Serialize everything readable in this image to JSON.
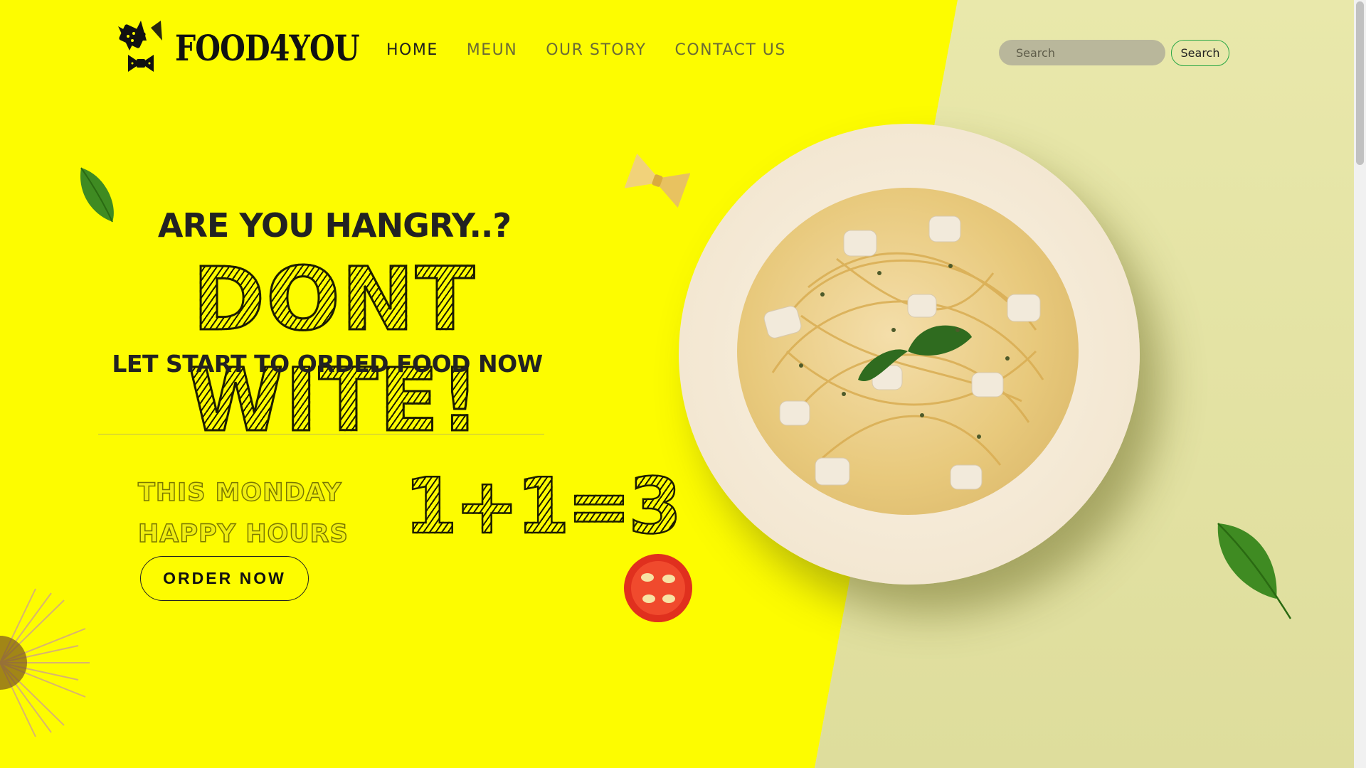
{
  "brand": {
    "name": "FOOD4YOU"
  },
  "nav": {
    "items": [
      {
        "label": "HOME",
        "active": true
      },
      {
        "label": "MEUN",
        "active": false
      },
      {
        "label": "OUR STORY",
        "active": false
      },
      {
        "label": "CONTACT US",
        "active": false
      }
    ]
  },
  "search": {
    "placeholder": "Search",
    "button_label": "Search"
  },
  "hero": {
    "line1": "ARE YOU HANGRY..?",
    "line2": "DONT WITE!",
    "line3": "LET START TO ORDED FOOD NOW"
  },
  "promo": {
    "line1": "THIS MONDAY",
    "line2": "HAPPY HOURS",
    "deal": "1+1=3",
    "button_label": "ORDER NOW"
  },
  "colors": {
    "background_yellow": "#fdfc00",
    "background_beige": "#e4e2a0",
    "search_button_border": "#28a745"
  },
  "icons": {
    "logo": "bow-tie-pasta-icon",
    "decorations": [
      "basil-leaf-icon",
      "farfalle-pasta-icon",
      "tomato-slice-icon",
      "spaghetti-bundle-icon",
      "basil-leaf-icon"
    ]
  }
}
